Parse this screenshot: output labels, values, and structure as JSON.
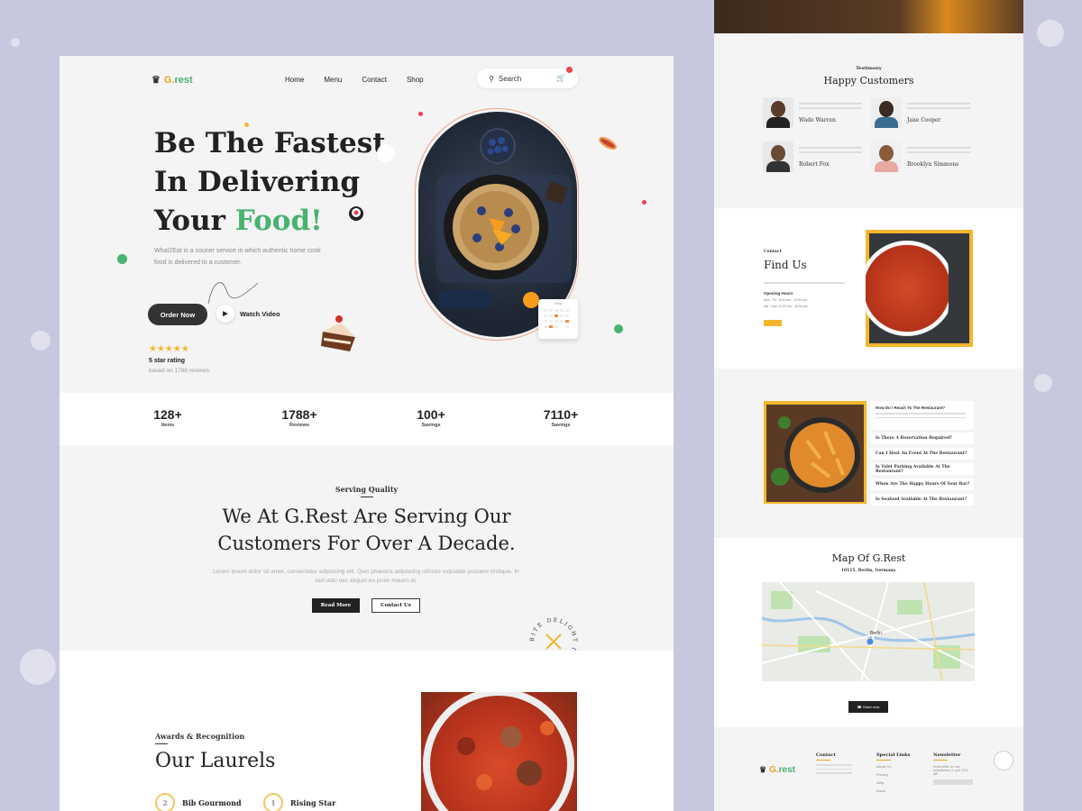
{
  "brand": {
    "logo_g": "G.",
    "logo_rest": "rest"
  },
  "nav": {
    "links": [
      "Home",
      "Menu",
      "Contact",
      "Shop"
    ],
    "search_placeholder": "Search"
  },
  "hero": {
    "title_line1": "Be The Fastest",
    "title_line2": "In Delivering",
    "title_line3_prefix": "Your ",
    "title_line3_accent": "Food!",
    "subtitle": "What2Eat is a courier service in which authentic home cook food is delivered to a customer.",
    "order_button": "Order Now",
    "watch_video": "Watch Video",
    "stars": "★★★★★",
    "rating_title": "5 star rating",
    "rating_sub": "based on 1788 reviews",
    "calendar_label": "Today"
  },
  "stats": [
    {
      "value": "128+",
      "label": "Items"
    },
    {
      "value": "1788+",
      "label": "Reviews"
    },
    {
      "value": "100+",
      "label": "Savings"
    },
    {
      "value": "7110+",
      "label": "Savings"
    }
  ],
  "serving": {
    "kicker": "Serving Quality",
    "heading_line1": "We At G.Rest Are Serving Our",
    "heading_line2": "Customers For Over A Decade.",
    "paragraph": "Lorem ipsum dolor sit amet, consectetur adipiscing elit. Quis pharetra adipiscing ultrices vulputate posuere tristique. In sed odio nec aliquet eu proin mauris et.",
    "read_more": "Read More",
    "contact_us": "Contact Us",
    "badge_text": "BITE DELIGHT IN EVERY"
  },
  "laurels": {
    "kicker": "Awards & Recognition",
    "heading": "Our Laurels",
    "awards": [
      {
        "rank": "2",
        "name": "Bib Gourmond"
      },
      {
        "rank": "1",
        "name": "Rising Star"
      }
    ]
  },
  "testimony": {
    "kicker": "Testimony",
    "heading": "Happy Customers",
    "customers": [
      "Wade Warren",
      "Jane Cooper",
      "Robert Fox",
      "Brooklyn Simmons"
    ]
  },
  "find": {
    "kicker": "Contact",
    "heading": "Find Us",
    "hours_title": "Opening Hours",
    "hours_line1": "Mon - Fri: 11:00 am - 10:30 pm",
    "hours_line2": "Sat - Sun: 11:00 am - 10:00 pm"
  },
  "faq": [
    "How Do I Reach To The Restaurant?",
    "Is There A Reservation Required?",
    "Can I Host An Event At The Restaurant?",
    "Is Valet Parking Available At The Restaurant?",
    "When Are The Happy Hours Of Your Bar?",
    "Is Seafood Available At The Restaurant?"
  ],
  "map": {
    "heading": "Map Of G.Rest",
    "address": "10115, Berlin, Germany.",
    "city_label": "Berlin",
    "order_button": "Order now"
  },
  "footer": {
    "contact_title": "Contact",
    "links_title": "Special Links",
    "links": [
      "About Us",
      "Pricing",
      "Help",
      "Menu"
    ],
    "newsletter_title": "Newsletter",
    "newsletter_text": "Subscribe to our newsletter & get 10% off"
  },
  "colors": {
    "accent_green": "#47b36f",
    "accent_yellow": "#f3b62d",
    "dark": "#222222"
  }
}
